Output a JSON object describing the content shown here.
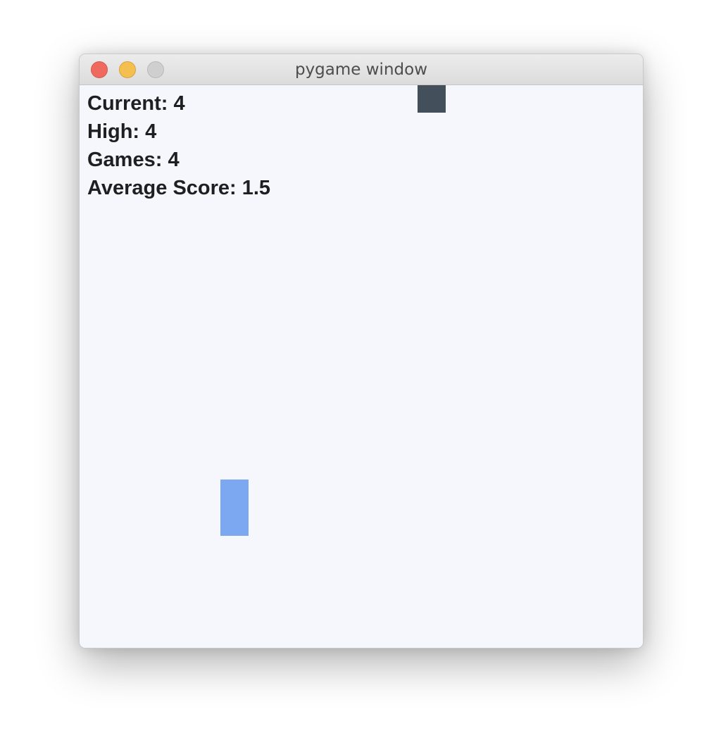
{
  "window": {
    "title": "pygame window"
  },
  "stats": {
    "current": "Current: 4",
    "high": "High: 4",
    "games": "Games: 4",
    "average": "Average Score: 1.5"
  },
  "colors": {
    "falling_block": "#444f5c",
    "player_paddle": "#7ca8f2",
    "background": "#f5f7fc"
  }
}
